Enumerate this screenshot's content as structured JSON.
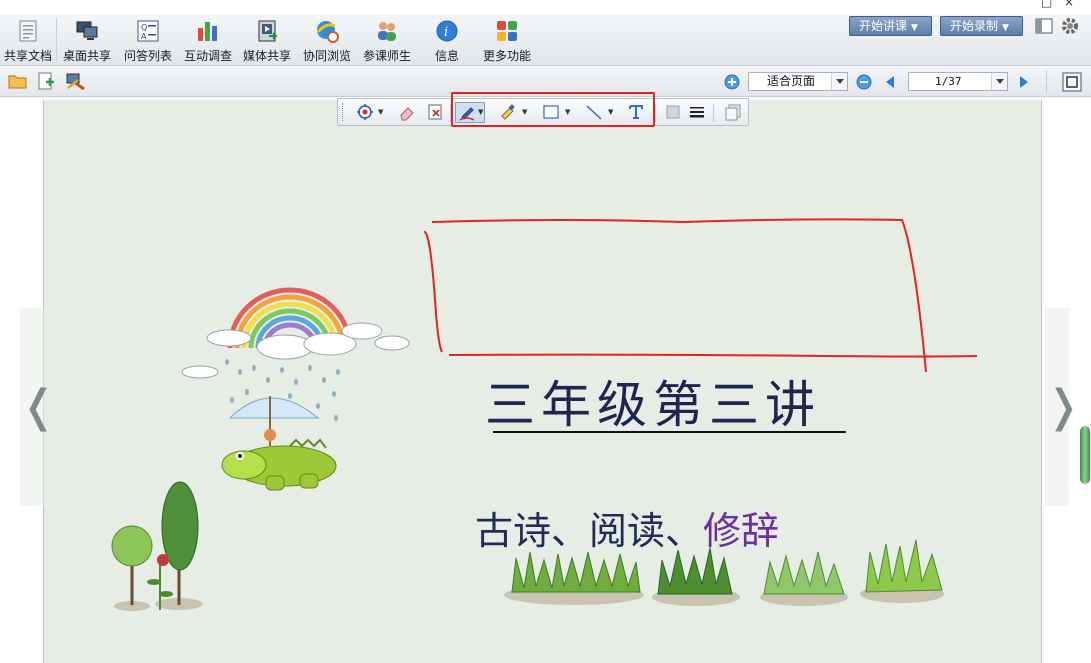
{
  "window": {
    "minimize_glyph": "□",
    "close_glyph": "×"
  },
  "toolbar": {
    "items": [
      {
        "label": "共享文档",
        "icon": "document-icon"
      },
      {
        "label": "桌面共享",
        "icon": "desktop-share-icon"
      },
      {
        "label": "问答列表",
        "icon": "qa-list-icon"
      },
      {
        "label": "互动调查",
        "icon": "survey-chart-icon"
      },
      {
        "label": "媒体共享",
        "icon": "media-share-icon"
      },
      {
        "label": "协同浏览",
        "icon": "co-browse-icon"
      },
      {
        "label": "参课师生",
        "icon": "participants-icon"
      },
      {
        "label": "信息",
        "icon": "info-icon"
      },
      {
        "label": "更多功能",
        "icon": "more-functions-icon"
      }
    ],
    "start_class": "开始讲课",
    "start_record": "开始录制"
  },
  "viewer": {
    "zoom_mode": "适合页面",
    "page_indicator": "1/37"
  },
  "slide": {
    "title": "三年级第三讲",
    "subtitle_part1": "古诗、阅读、",
    "subtitle_part2": "修辞",
    "prev_glyph": "❬",
    "next_glyph": "❭"
  },
  "colors": {
    "slide_bg": "#e6ede5",
    "title": "#1c2650",
    "subtitle": "#1e2d58",
    "subtitle_accent": "#6b2fa0",
    "annotation_ink": "#e32323",
    "header_button": "#6d8bb3"
  }
}
